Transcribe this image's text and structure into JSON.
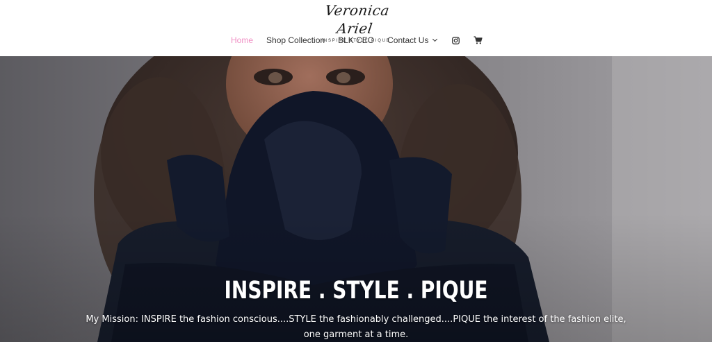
{
  "brand": {
    "logo_script": "Veronica Ariel",
    "logo_tagline": "INSPIRE  STYLE  PIQUE"
  },
  "nav": {
    "items": [
      {
        "label": "Home",
        "active": true
      },
      {
        "label": "Shop Collection",
        "active": false
      },
      {
        "label": "BLK CEO",
        "active": false
      },
      {
        "label": "Contact Us",
        "active": false,
        "has_dropdown": true
      }
    ],
    "icons": [
      "instagram-icon",
      "shopping-cart-icon"
    ],
    "active_color": "#f08fc4"
  },
  "hero": {
    "title": "INSPIRE . STYLE . PIQUE",
    "text": "My Mission: INSPIRE the fashion conscious....STYLE the fashionably challenged....PIQUE the interest of the fashion elite, one garment at a time."
  }
}
